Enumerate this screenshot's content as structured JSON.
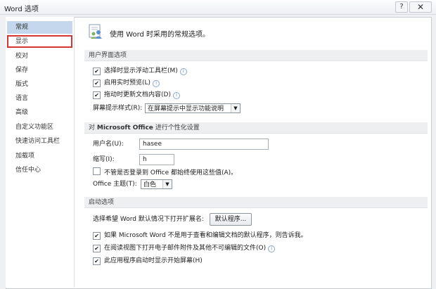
{
  "window": {
    "title": "Word 选项",
    "help": "?",
    "close": "✕"
  },
  "sidebar": {
    "items": [
      {
        "label": "常规"
      },
      {
        "label": "显示"
      },
      {
        "label": "校对"
      },
      {
        "label": "保存"
      },
      {
        "label": "版式"
      },
      {
        "label": "语言"
      },
      {
        "label": "高级"
      },
      {
        "label": "自定义功能区"
      },
      {
        "label": "快速访问工具栏"
      },
      {
        "label": "加载项"
      },
      {
        "label": "信任中心"
      }
    ]
  },
  "main": {
    "header": "使用 Word 时采用的常规选项。",
    "ui_section": {
      "title": "用户界面选项",
      "options": [
        {
          "label": "选择时显示浮动工具栏(M)",
          "checked": true
        },
        {
          "label": "启用实时预览(L)",
          "checked": true
        },
        {
          "label": "拖动时更新文档内容(D)",
          "checked": true
        }
      ],
      "tooltip_label": "屏幕提示样式(R):",
      "tooltip_value": "在屏幕提示中显示功能说明"
    },
    "personal_section": {
      "title_prefix": "对",
      "title_bold": "Microsoft Office",
      "title_suffix": "进行个性化设置",
      "username_label": "用户名(U):",
      "username_value": "hasee",
      "initials_label": "缩写(I):",
      "initials_value": "h",
      "always_use_label": "不管是否登录到 Office 都始终使用这些值(A)。",
      "always_use_checked": false,
      "theme_label": "Office 主题(T):",
      "theme_value": "白色"
    },
    "startup_section": {
      "title": "启动选项",
      "default_ext_label": "选择希望 Word 默认情况下打开扩展名:",
      "default_programs_button": "默认程序...",
      "options": [
        {
          "label": "如果 Microsoft Word 不是用于查看和编辑文档的默认程序，则告诉我。",
          "checked": true
        },
        {
          "label": "在阅读视图下打开电子邮件附件及其他不可编辑的文件(O)",
          "checked": true
        },
        {
          "label": "此应用程序启动时显示开始屏幕(H)",
          "checked": true
        }
      ]
    }
  },
  "colors": {
    "active_nav": "#c4d7ed",
    "highlight_box": "#d53434"
  }
}
